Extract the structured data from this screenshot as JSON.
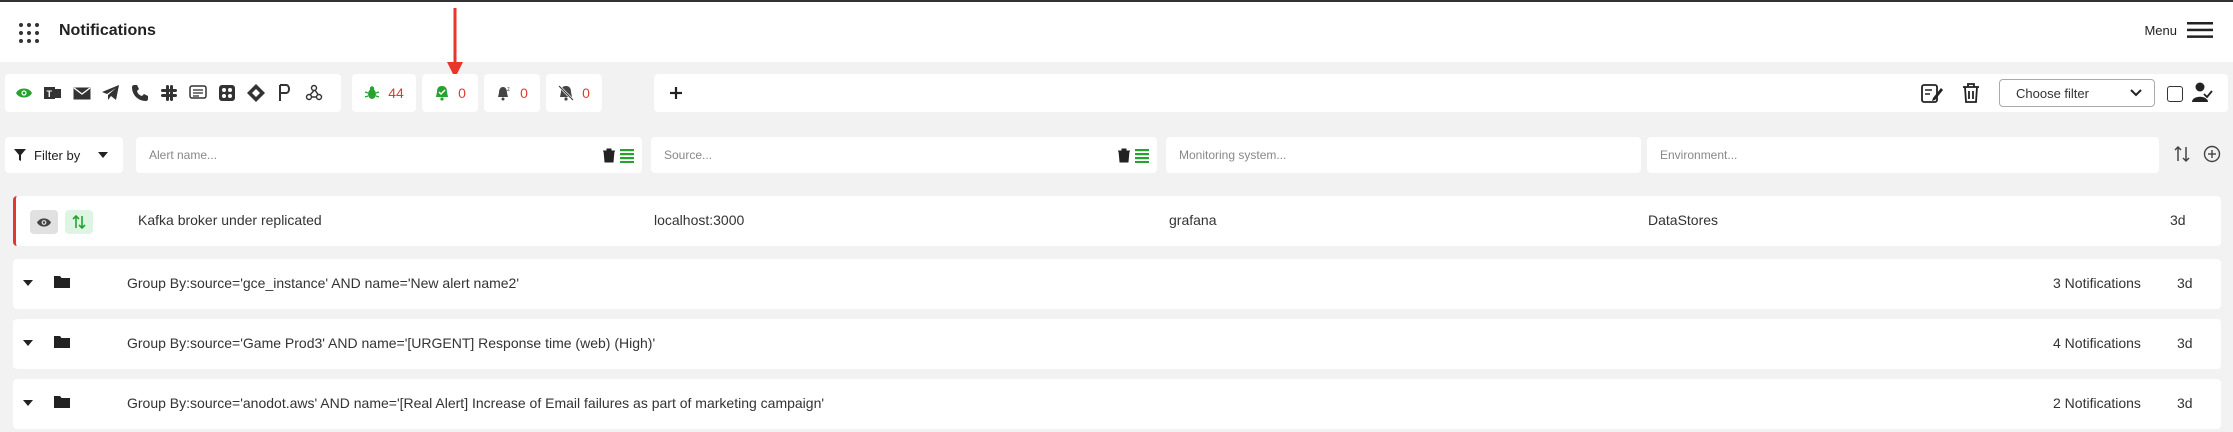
{
  "header": {
    "title": "Notifications",
    "menu_label": "Menu"
  },
  "channels": [
    "eye-icon",
    "teams-icon",
    "mail-icon",
    "telegram-icon",
    "phone-icon",
    "slack-icon",
    "sms-icon",
    "webhook-icon",
    "jira-icon",
    "pagerduty-icon",
    "other-webhook-icon"
  ],
  "counters": [
    {
      "name": "active-counter",
      "value": "44",
      "color": "#25a32e"
    },
    {
      "name": "acked-counter",
      "value": "0",
      "color": "#25a32e"
    },
    {
      "name": "snoozed-counter",
      "value": "0",
      "color": "#444444"
    },
    {
      "name": "muted-counter",
      "value": "0",
      "color": "#444444"
    }
  ],
  "toolbar": {
    "choose_filter": "Choose filter"
  },
  "filters": {
    "filter_by": "Filter by",
    "alert_name_placeholder": "Alert name...",
    "source_placeholder": "Source...",
    "monitoring_placeholder": "Monitoring system...",
    "environment_placeholder": "Environment..."
  },
  "alert": {
    "name": "Kafka broker under replicated",
    "source": "localhost:3000",
    "monitoring": "grafana",
    "environment": "DataStores",
    "age": "3d"
  },
  "groups": [
    {
      "label": "Group By:source='gce_instance' AND name='New alert name2'",
      "count": "3 Notifications",
      "age": "3d"
    },
    {
      "label": "Group By:source='Game Prod3' AND name='[URGENT] Response time (web) (High)'",
      "count": "4 Notifications",
      "age": "3d"
    },
    {
      "label": "Group By:source='anodot.aws' AND name='[Real Alert] Increase of Email failures as part of marketing campaign'",
      "count": "2 Notifications",
      "age": "3d"
    }
  ],
  "colors": {
    "accent_green": "#25a32e",
    "alert_red": "#e03a2e"
  }
}
